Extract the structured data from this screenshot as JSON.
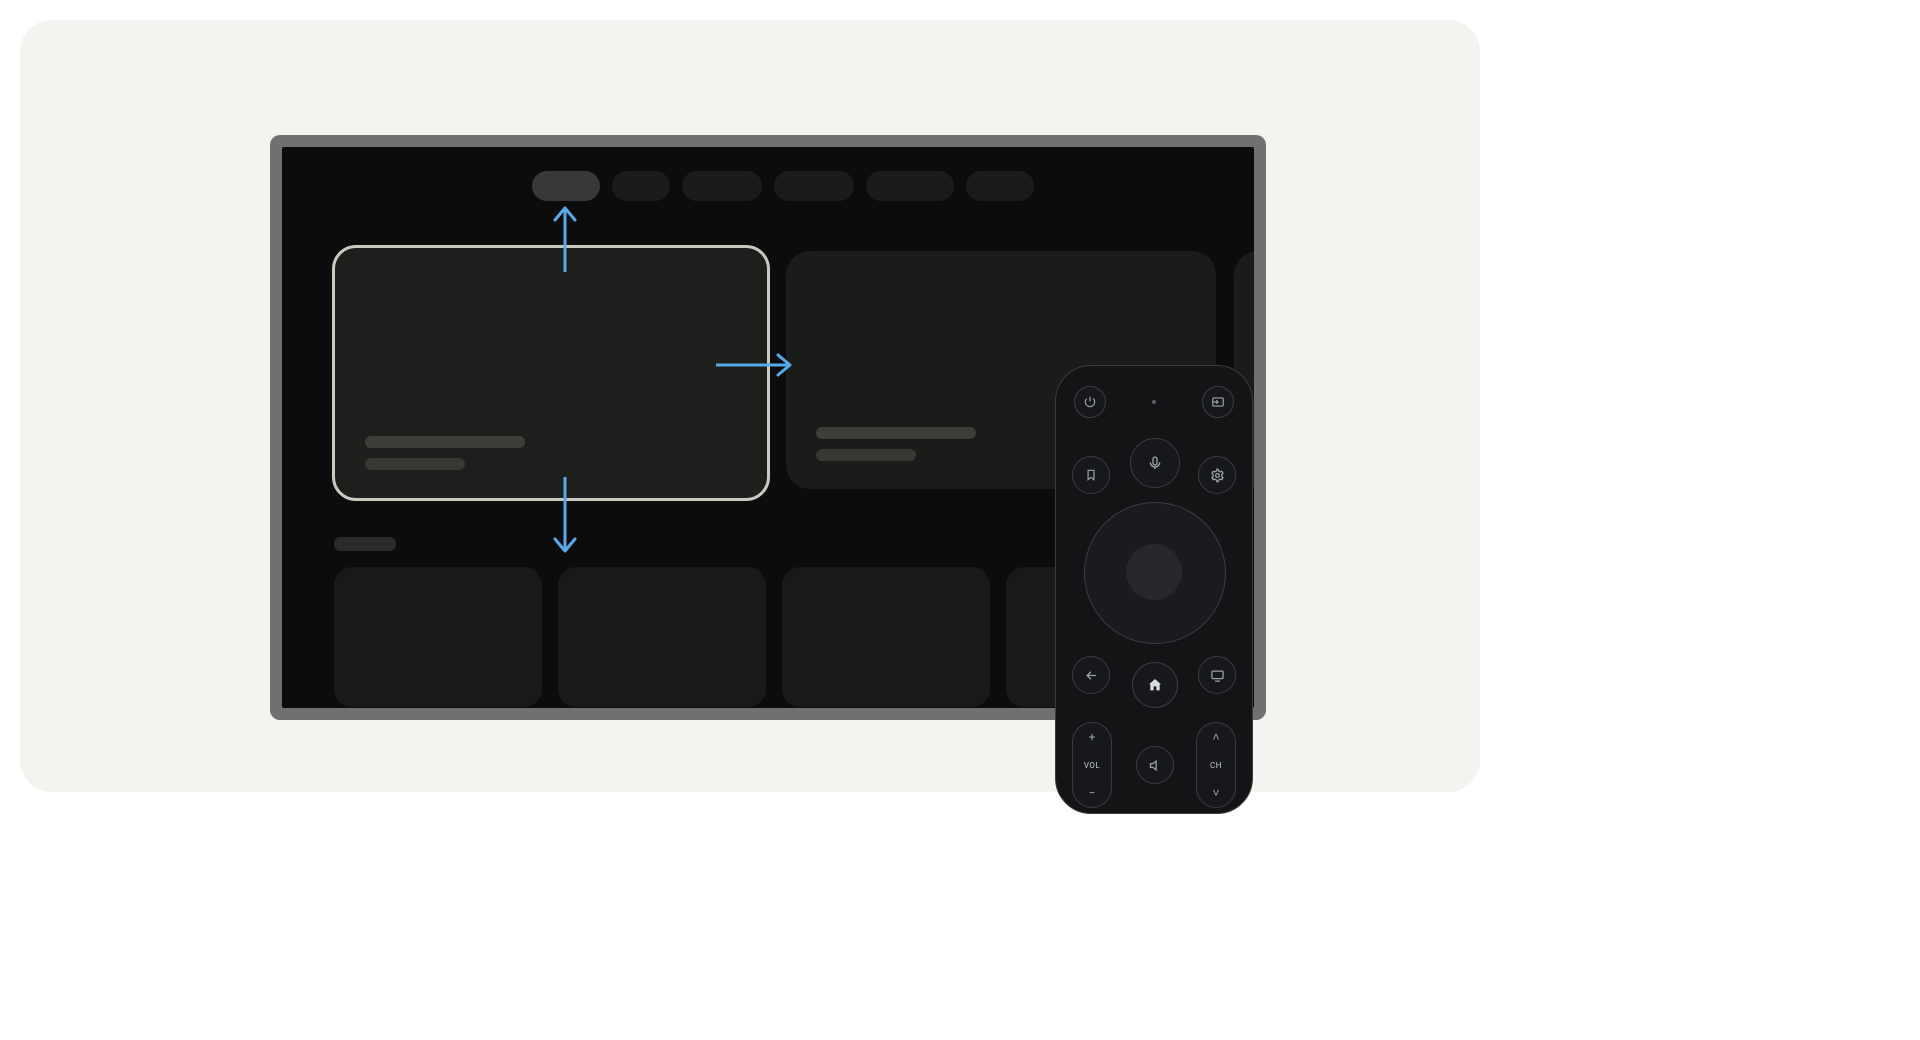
{
  "colors": {
    "background": "#f2f4f0",
    "tv_bezel": "#707070",
    "tv_screen": "#0c0c0c",
    "arrow": "#59a9e8",
    "focus_ring": "#c8c9bf",
    "remote_body": "#131416",
    "remote_outline": "#3a3c3f"
  },
  "tv": {
    "nav_pills": 6,
    "active_pill_index": 0,
    "hero_focused_index": 0,
    "row_cards": 4
  },
  "arrows": {
    "up": true,
    "right": true,
    "down": true
  },
  "remote": {
    "top_row": {
      "left": "power",
      "right": "input"
    },
    "indicator_dot": true,
    "row2": {
      "left": "bookmark",
      "center": "mic",
      "right": "settings"
    },
    "dpad": true,
    "row4": {
      "left": "back",
      "center": "home",
      "right": "tv"
    },
    "bottom": {
      "left_rocker": {
        "label": "VOL",
        "plus": "+",
        "minus": "−"
      },
      "center": "mute",
      "right_rocker": {
        "label": "CH",
        "up": "˄",
        "down": "˅"
      }
    }
  }
}
